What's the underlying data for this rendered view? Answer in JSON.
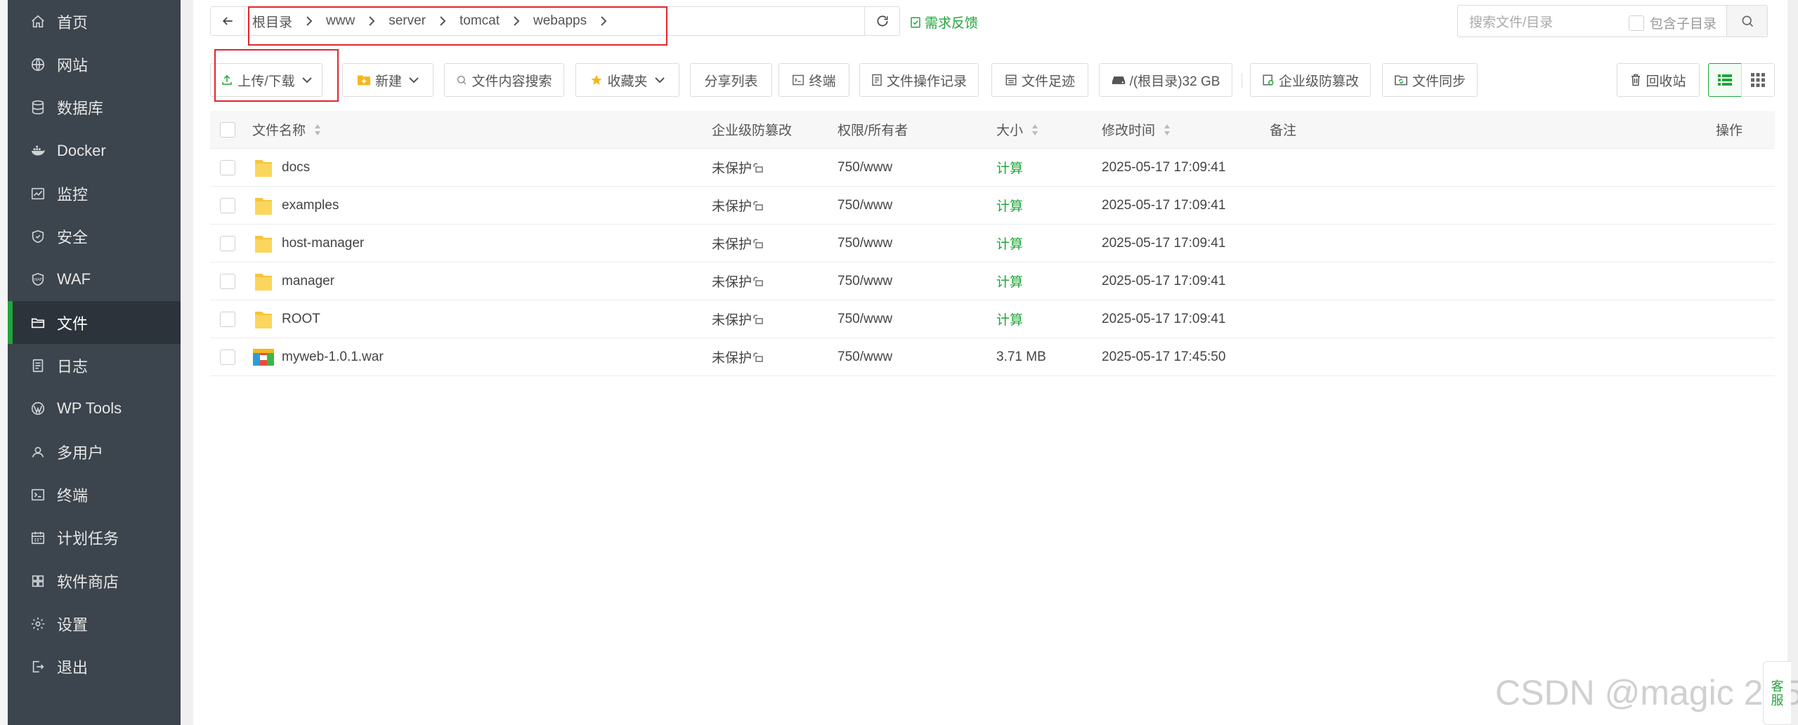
{
  "sidebar": {
    "items": [
      {
        "label": "首页",
        "icon": "home-icon"
      },
      {
        "label": "网站",
        "icon": "globe-icon"
      },
      {
        "label": "数据库",
        "icon": "database-icon"
      },
      {
        "label": "Docker",
        "icon": "docker-icon"
      },
      {
        "label": "监控",
        "icon": "monitor-icon"
      },
      {
        "label": "安全",
        "icon": "shield-icon"
      },
      {
        "label": "WAF",
        "icon": "waf-icon"
      },
      {
        "label": "文件",
        "icon": "folder-icon",
        "active": true
      },
      {
        "label": "日志",
        "icon": "log-icon"
      },
      {
        "label": "WP Tools",
        "icon": "wordpress-icon"
      },
      {
        "label": "多用户",
        "icon": "users-icon"
      },
      {
        "label": "终端",
        "icon": "terminal-icon"
      },
      {
        "label": "计划任务",
        "icon": "calendar-icon"
      },
      {
        "label": "软件商店",
        "icon": "apps-icon"
      },
      {
        "label": "设置",
        "icon": "gear-icon"
      },
      {
        "label": "退出",
        "icon": "logout-icon"
      }
    ]
  },
  "breadcrumb": [
    "根目录",
    "www",
    "server",
    "tomcat",
    "webapps"
  ],
  "feedback_label": "需求反馈",
  "search": {
    "placeholder": "搜索文件/目录",
    "include_sub_label": "包含子目录"
  },
  "toolbar": {
    "upload_download": "上传/下载",
    "new": "新建",
    "content_search": "文件内容搜索",
    "favorites": "收藏夹",
    "share_list": "分享列表",
    "terminal": "终端",
    "op_log": "文件操作记录",
    "footprint": "文件足迹",
    "disk": "/(根目录)32 GB",
    "tamper": "企业级防篡改",
    "sync": "文件同步",
    "recycle": "回收站"
  },
  "table": {
    "headers": {
      "name": "文件名称",
      "protect": "企业级防篡改",
      "perm": "权限/所有者",
      "size": "大小",
      "mtime": "修改时间",
      "note": "备注",
      "op": "操作"
    },
    "rows": [
      {
        "name": "docs",
        "type": "folder",
        "protect": "未保护",
        "perm": "750/www",
        "size": "计算",
        "mtime": "2025-05-17 17:09:41"
      },
      {
        "name": "examples",
        "type": "folder",
        "protect": "未保护",
        "perm": "750/www",
        "size": "计算",
        "mtime": "2025-05-17 17:09:41"
      },
      {
        "name": "host-manager",
        "type": "folder",
        "protect": "未保护",
        "perm": "750/www",
        "size": "计算",
        "mtime": "2025-05-17 17:09:41"
      },
      {
        "name": "manager",
        "type": "folder",
        "protect": "未保护",
        "perm": "750/www",
        "size": "计算",
        "mtime": "2025-05-17 17:09:41"
      },
      {
        "name": "ROOT",
        "type": "folder",
        "protect": "未保护",
        "perm": "750/www",
        "size": "计算",
        "mtime": "2025-05-17 17:09:41"
      },
      {
        "name": "myweb-1.0.1.war",
        "type": "archive",
        "protect": "未保护",
        "perm": "750/www",
        "size": "3.71 MB",
        "mtime": "2025-05-17 17:45:50"
      }
    ]
  },
  "watermark": "CSDN @magic 245",
  "service_tab": [
    "客",
    "服"
  ],
  "colors": {
    "accent": "#20a53a",
    "sidebar_bg": "#3c444d",
    "highlight_red": "#e0262b"
  }
}
